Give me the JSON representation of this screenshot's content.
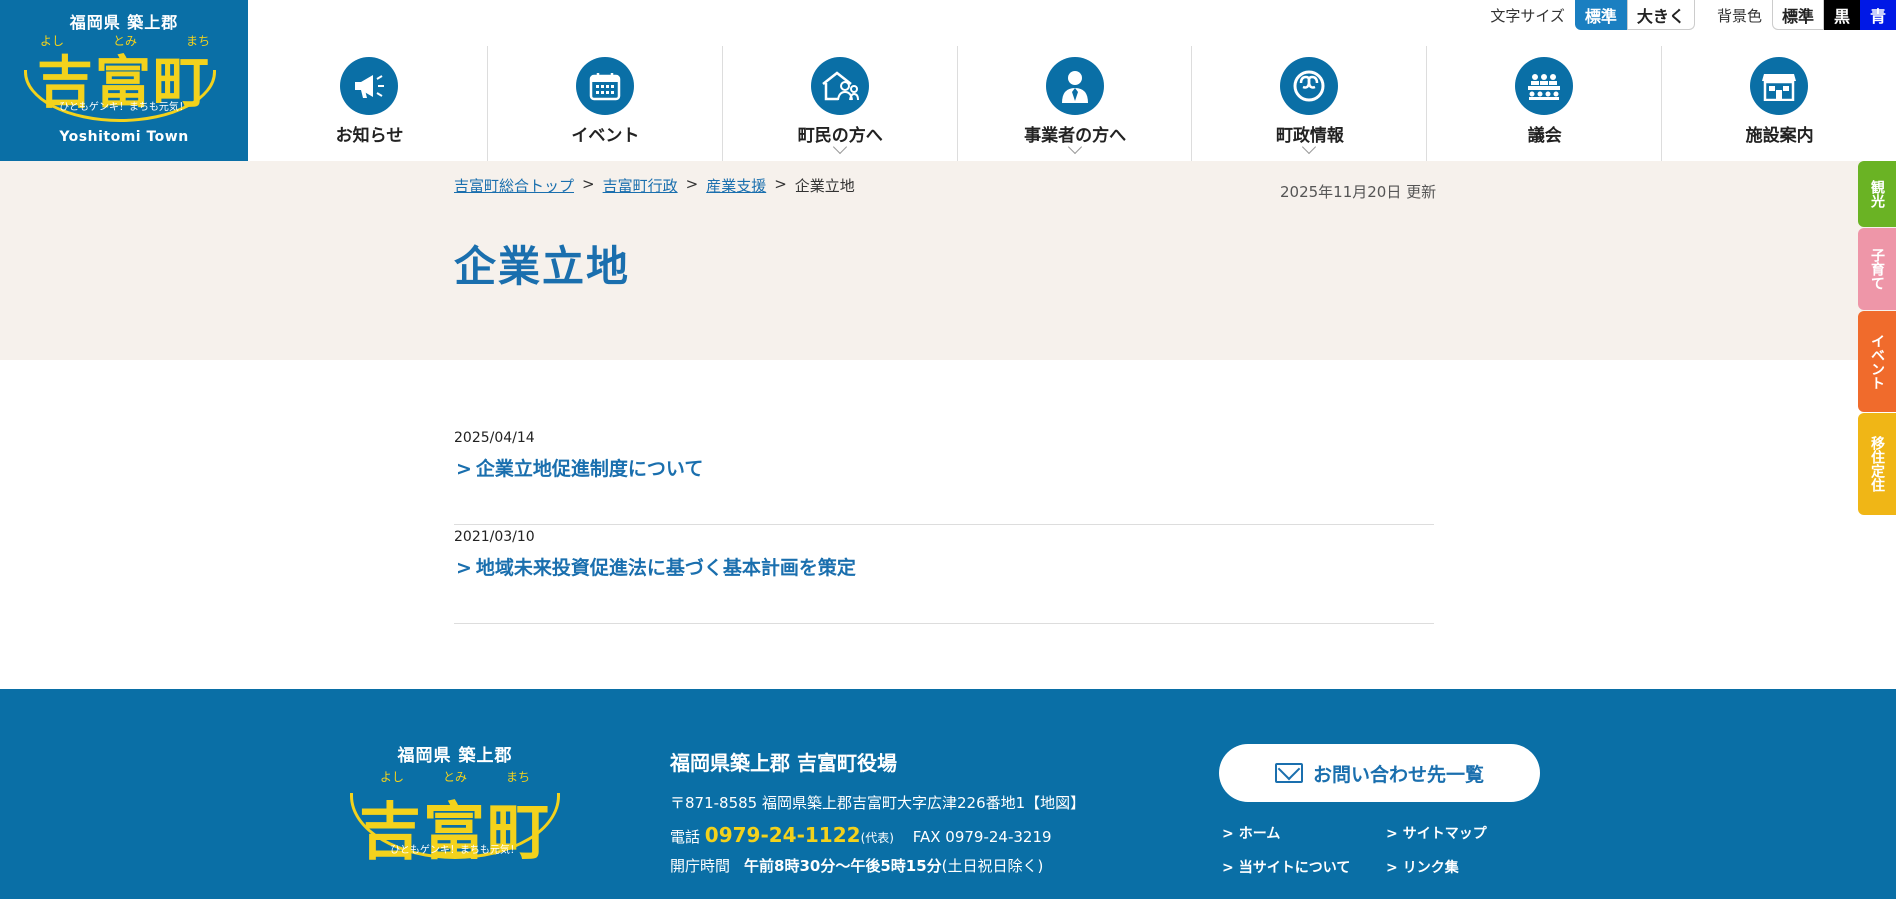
{
  "site": {
    "pref": "福岡県 築上郡",
    "ruby": [
      "よし",
      "とみ",
      "まち"
    ],
    "town_name": "吉富町",
    "slogan": "ひともゲンキ！まちも元気！",
    "town_en": "Yoshitomi Town"
  },
  "accessibility": {
    "font_size_label": "文字サイズ",
    "font_standard": "標準",
    "font_large": "大きく",
    "bg_label": "背景色",
    "bg_standard": "標準",
    "bg_black": "黒",
    "bg_blue": "青"
  },
  "nav": {
    "items": [
      {
        "label": "お知らせ",
        "icon": "megaphone-icon"
      },
      {
        "label": "イベント",
        "icon": "calendar-icon"
      },
      {
        "label": "町民の方へ",
        "icon": "family-house-icon"
      },
      {
        "label": "事業者の方へ",
        "icon": "businessman-icon"
      },
      {
        "label": "町政情報",
        "icon": "town-emblem-icon"
      },
      {
        "label": "議会",
        "icon": "assembly-icon"
      },
      {
        "label": "施設案内",
        "icon": "building-icon"
      }
    ]
  },
  "breadcrumb": {
    "items": [
      "吉富町総合トップ",
      "吉富町行政",
      "産業支援"
    ],
    "current": "企業立地",
    "separator": ">"
  },
  "page": {
    "updated": "2025年11月20日 更新",
    "title": "企業立地"
  },
  "entries": [
    {
      "date": "2025/04/14",
      "title": "企業立地促進制度について"
    },
    {
      "date": "2021/03/10",
      "title": "地域未来投資促進法に基づく基本計画を策定"
    }
  ],
  "side_tabs": {
    "kanko": "観光",
    "kosodate": "子育て",
    "event": "イベント",
    "iju": "移住定住"
  },
  "footer": {
    "org": "福岡県築上郡 吉富町役場",
    "address": "〒871-8585 福岡県築上郡吉富町大字広津226番地1【地図】",
    "tel_label": "電話",
    "tel_number": "0979-24-1122",
    "tel_note": "(代表)",
    "fax": "FAX 0979-24-3219",
    "hours_label": "開庁時間",
    "hours_value": "午前8時30分～午後5時15分",
    "hours_note": "(土日祝日除く)",
    "contact_button": "お問い合わせ先一覧",
    "links": [
      "ホーム",
      "サイトマップ",
      "当サイトについて",
      "リンク集"
    ]
  },
  "colors": {
    "brand_blue": "#0a6fa6",
    "logo_yellow": "#f3d21c",
    "title_bg": "#f6f1ec",
    "tab_kanko": "#6ab324",
    "tab_kosodate": "#ee96a8",
    "tab_event": "#f06b2c",
    "tab_iju": "#f0b616"
  }
}
